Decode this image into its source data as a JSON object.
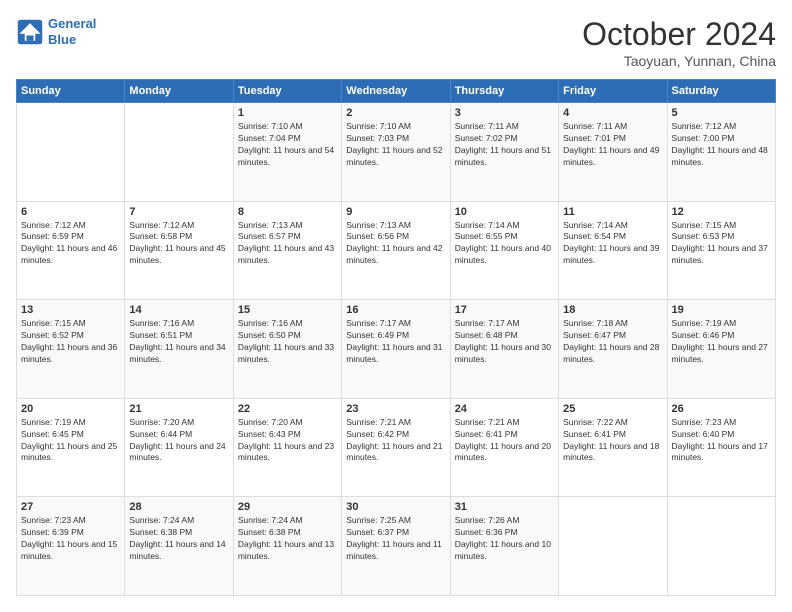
{
  "logo": {
    "line1": "General",
    "line2": "Blue"
  },
  "header": {
    "month_title": "October 2024",
    "location": "Taoyuan, Yunnan, China"
  },
  "weekdays": [
    "Sunday",
    "Monday",
    "Tuesday",
    "Wednesday",
    "Thursday",
    "Friday",
    "Saturday"
  ],
  "weeks": [
    [
      {
        "day": "",
        "info": ""
      },
      {
        "day": "",
        "info": ""
      },
      {
        "day": "1",
        "info": "Sunrise: 7:10 AM\nSunset: 7:04 PM\nDaylight: 11 hours and 54 minutes."
      },
      {
        "day": "2",
        "info": "Sunrise: 7:10 AM\nSunset: 7:03 PM\nDaylight: 11 hours and 52 minutes."
      },
      {
        "day": "3",
        "info": "Sunrise: 7:11 AM\nSunset: 7:02 PM\nDaylight: 11 hours and 51 minutes."
      },
      {
        "day": "4",
        "info": "Sunrise: 7:11 AM\nSunset: 7:01 PM\nDaylight: 11 hours and 49 minutes."
      },
      {
        "day": "5",
        "info": "Sunrise: 7:12 AM\nSunset: 7:00 PM\nDaylight: 11 hours and 48 minutes."
      }
    ],
    [
      {
        "day": "6",
        "info": "Sunrise: 7:12 AM\nSunset: 6:59 PM\nDaylight: 11 hours and 46 minutes."
      },
      {
        "day": "7",
        "info": "Sunrise: 7:12 AM\nSunset: 6:58 PM\nDaylight: 11 hours and 45 minutes."
      },
      {
        "day": "8",
        "info": "Sunrise: 7:13 AM\nSunset: 6:57 PM\nDaylight: 11 hours and 43 minutes."
      },
      {
        "day": "9",
        "info": "Sunrise: 7:13 AM\nSunset: 6:56 PM\nDaylight: 11 hours and 42 minutes."
      },
      {
        "day": "10",
        "info": "Sunrise: 7:14 AM\nSunset: 6:55 PM\nDaylight: 11 hours and 40 minutes."
      },
      {
        "day": "11",
        "info": "Sunrise: 7:14 AM\nSunset: 6:54 PM\nDaylight: 11 hours and 39 minutes."
      },
      {
        "day": "12",
        "info": "Sunrise: 7:15 AM\nSunset: 6:53 PM\nDaylight: 11 hours and 37 minutes."
      }
    ],
    [
      {
        "day": "13",
        "info": "Sunrise: 7:15 AM\nSunset: 6:52 PM\nDaylight: 11 hours and 36 minutes."
      },
      {
        "day": "14",
        "info": "Sunrise: 7:16 AM\nSunset: 6:51 PM\nDaylight: 11 hours and 34 minutes."
      },
      {
        "day": "15",
        "info": "Sunrise: 7:16 AM\nSunset: 6:50 PM\nDaylight: 11 hours and 33 minutes."
      },
      {
        "day": "16",
        "info": "Sunrise: 7:17 AM\nSunset: 6:49 PM\nDaylight: 11 hours and 31 minutes."
      },
      {
        "day": "17",
        "info": "Sunrise: 7:17 AM\nSunset: 6:48 PM\nDaylight: 11 hours and 30 minutes."
      },
      {
        "day": "18",
        "info": "Sunrise: 7:18 AM\nSunset: 6:47 PM\nDaylight: 11 hours and 28 minutes."
      },
      {
        "day": "19",
        "info": "Sunrise: 7:19 AM\nSunset: 6:46 PM\nDaylight: 11 hours and 27 minutes."
      }
    ],
    [
      {
        "day": "20",
        "info": "Sunrise: 7:19 AM\nSunset: 6:45 PM\nDaylight: 11 hours and 25 minutes."
      },
      {
        "day": "21",
        "info": "Sunrise: 7:20 AM\nSunset: 6:44 PM\nDaylight: 11 hours and 24 minutes."
      },
      {
        "day": "22",
        "info": "Sunrise: 7:20 AM\nSunset: 6:43 PM\nDaylight: 11 hours and 23 minutes."
      },
      {
        "day": "23",
        "info": "Sunrise: 7:21 AM\nSunset: 6:42 PM\nDaylight: 11 hours and 21 minutes."
      },
      {
        "day": "24",
        "info": "Sunrise: 7:21 AM\nSunset: 6:41 PM\nDaylight: 11 hours and 20 minutes."
      },
      {
        "day": "25",
        "info": "Sunrise: 7:22 AM\nSunset: 6:41 PM\nDaylight: 11 hours and 18 minutes."
      },
      {
        "day": "26",
        "info": "Sunrise: 7:23 AM\nSunset: 6:40 PM\nDaylight: 11 hours and 17 minutes."
      }
    ],
    [
      {
        "day": "27",
        "info": "Sunrise: 7:23 AM\nSunset: 6:39 PM\nDaylight: 11 hours and 15 minutes."
      },
      {
        "day": "28",
        "info": "Sunrise: 7:24 AM\nSunset: 6:38 PM\nDaylight: 11 hours and 14 minutes."
      },
      {
        "day": "29",
        "info": "Sunrise: 7:24 AM\nSunset: 6:38 PM\nDaylight: 11 hours and 13 minutes."
      },
      {
        "day": "30",
        "info": "Sunrise: 7:25 AM\nSunset: 6:37 PM\nDaylight: 11 hours and 11 minutes."
      },
      {
        "day": "31",
        "info": "Sunrise: 7:26 AM\nSunset: 6:36 PM\nDaylight: 11 hours and 10 minutes."
      },
      {
        "day": "",
        "info": ""
      },
      {
        "day": "",
        "info": ""
      }
    ]
  ]
}
